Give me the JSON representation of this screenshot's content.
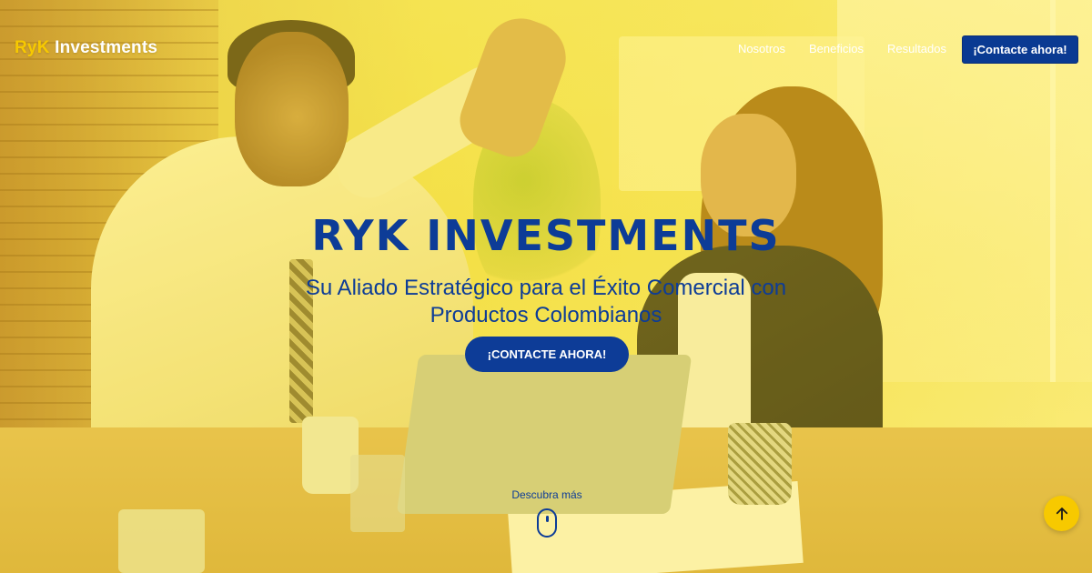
{
  "nav": {
    "logo_accent": "RyK",
    "logo_rest": " Investments",
    "links": [
      "Nosotros",
      "Beneficios",
      "Resultados"
    ],
    "cta_label": "¡Contacte ahora!"
  },
  "hero": {
    "title": "RYK INVESTMENTS",
    "subtitle": "Su Aliado Estratégico para el Éxito Comercial con Productos Colombianos",
    "cta_label": "¡CONTACTE AHORA!",
    "discover_label": "Descubra más"
  },
  "icons": {
    "scroll": "mouse-scroll-icon",
    "back_to_top": "arrow-up-icon"
  },
  "colors": {
    "primary_blue": "#0d3c97",
    "accent_yellow": "#f7c900",
    "overlay_yellow": "#ffe214"
  }
}
